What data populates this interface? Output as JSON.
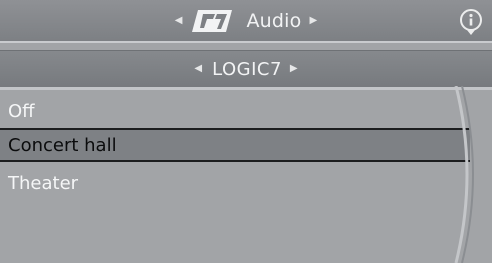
{
  "header": {
    "logo_icon": "logic7-logo-icon",
    "title": "Audio",
    "info_icon": "info-icon"
  },
  "subheader": {
    "label": "LOGIC7"
  },
  "list": {
    "items": [
      {
        "label": "Off",
        "selected": false
      },
      {
        "label": "Concert hall",
        "selected": true
      },
      {
        "label": "Theater",
        "selected": false
      }
    ]
  },
  "colors": {
    "background": "#a2a4a7",
    "header": "#7d8084",
    "selected_row": "#7e8185",
    "text": "#f5f6f7"
  }
}
